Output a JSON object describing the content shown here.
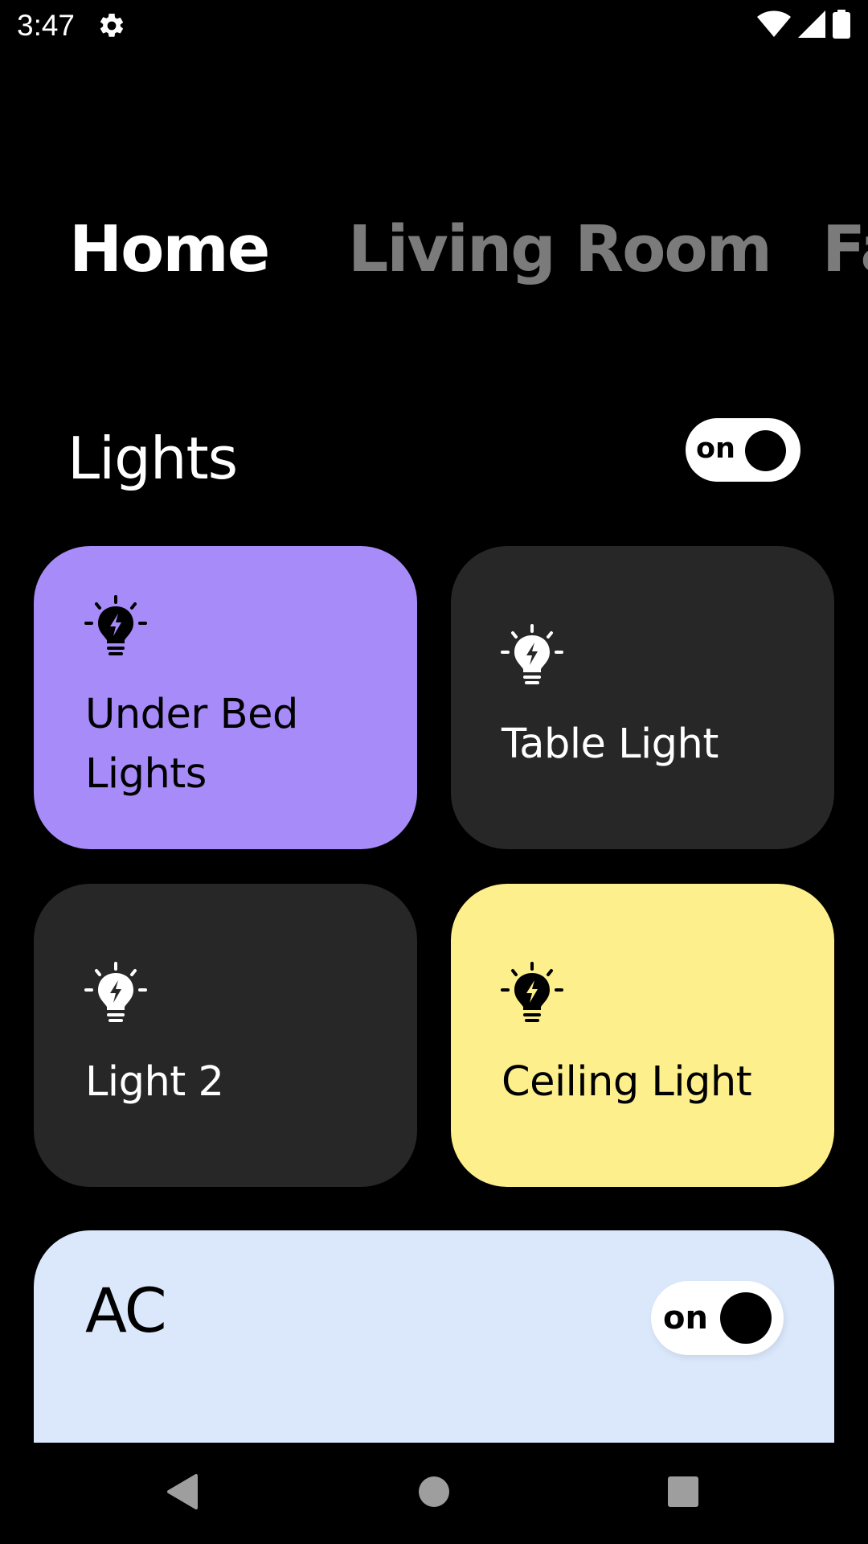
{
  "status_bar": {
    "time": "3:47",
    "icons": [
      "settings-gear-icon",
      "wifi-icon",
      "cell-signal-icon",
      "battery-icon"
    ]
  },
  "tabs": [
    {
      "label": "Home",
      "active": true
    },
    {
      "label": "Living Room",
      "active": false
    },
    {
      "label": "Fa",
      "active": false
    }
  ],
  "lights": {
    "title": "Lights",
    "toggle_label": "on",
    "cards": [
      {
        "label_line1": "Under Bed",
        "label_line2": "Lights",
        "color": "#a78bf8",
        "text_color": "#000000",
        "icon": "lightbulb-bolt-icon"
      },
      {
        "label_line1": "Table Light",
        "label_line2": "",
        "color": "#272727",
        "text_color": "#ffffff",
        "icon": "lightbulb-bolt-icon"
      },
      {
        "label_line1": "Light 2",
        "label_line2": "",
        "color": "#272727",
        "text_color": "#ffffff",
        "icon": "lightbulb-bolt-icon"
      },
      {
        "label_line1": "Ceiling Light",
        "label_line2": "",
        "color": "#fcef8c",
        "text_color": "#000000",
        "icon": "lightbulb-bolt-icon"
      }
    ]
  },
  "ac": {
    "title": "AC",
    "toggle_label": "on",
    "color": "#dbe8fb"
  },
  "nav_bar": {
    "icons": [
      "back-triangle-icon",
      "home-circle-icon",
      "recents-square-icon"
    ]
  }
}
